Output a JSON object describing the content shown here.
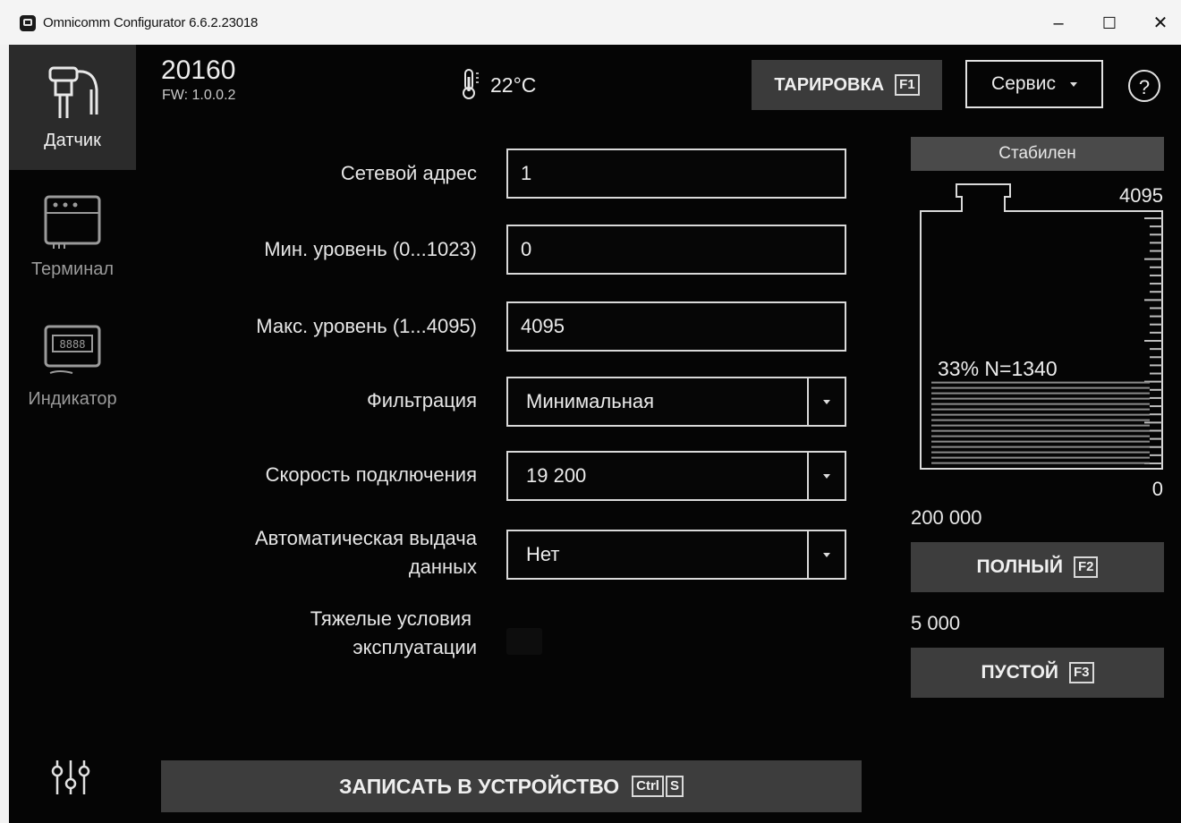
{
  "window": {
    "title": "Omnicomm Configurator 6.6.2.23018",
    "minimize": "–",
    "maximize": "☐",
    "close": "✕"
  },
  "sidebar": {
    "items": [
      {
        "label": "Датчик",
        "icon": "sensor-icon",
        "active": true
      },
      {
        "label": "Терминал",
        "icon": "terminal-icon",
        "active": false
      },
      {
        "label": "Индикатор",
        "icon": "indicator-icon",
        "active": false
      }
    ],
    "settings_icon": "sliders-icon"
  },
  "header": {
    "device_number": "20160",
    "firmware": "FW: 1.0.0.2",
    "temperature": "22°C",
    "calibration_button": "ТАРИРОВКА",
    "calibration_key": "F1",
    "service_button": "Сервис",
    "help": "?"
  },
  "form": {
    "network_address_label": "Сетевой адрес",
    "network_address_value": "1",
    "min_level_label": "Мин. уровень (0...1023)",
    "min_level_value": "0",
    "max_level_label": "Макс. уровень (1...4095)",
    "max_level_value": "4095",
    "filtering_label": "Фильтрация",
    "filtering_value": "Минимальная",
    "speed_label": "Скорость подключения",
    "speed_value": "19 200",
    "auto_output_label_1": "Автоматическая выдача",
    "auto_output_label_2": "данных",
    "auto_output_value": "Нет",
    "heavy_conditions_label_1": "Тяжелые условия",
    "heavy_conditions_label_2": "эксплуатации"
  },
  "write_button": {
    "label": "ЗАПИСАТЬ В УСТРОЙСТВО",
    "key1": "Ctrl",
    "key2": "S"
  },
  "tank": {
    "status": "Стабилен",
    "max_value": "4095",
    "min_value": "0",
    "level_text": "33% N=1340",
    "level_fraction": 0.33,
    "full_volume": "200 000",
    "full_button": "ПОЛНЫЙ",
    "full_key": "F2",
    "empty_volume": "5 000",
    "empty_button": "ПУСТОЙ",
    "empty_key": "F3"
  }
}
